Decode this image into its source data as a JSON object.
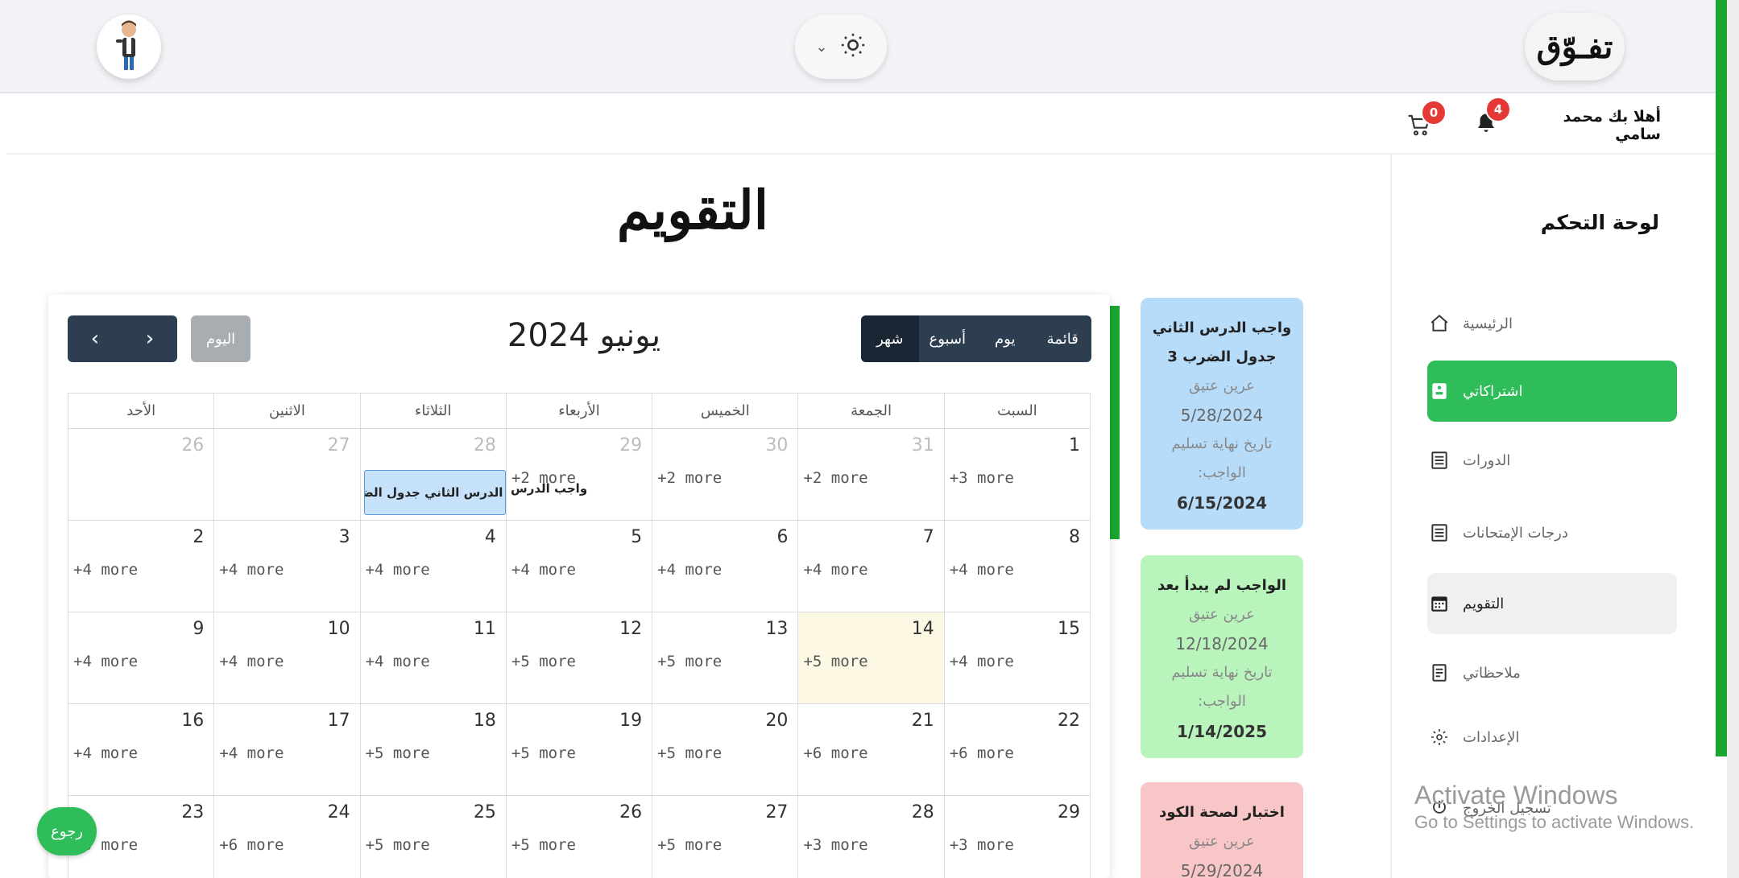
{
  "header": {
    "logo": "تفـوّق",
    "avatar_alt": "avatar"
  },
  "topbar": {
    "greeting": "أهلا بك محمد سامي",
    "notifications_count": "4",
    "cart_count": "0"
  },
  "sidebar": {
    "title": "لوحة التحكم",
    "items": [
      {
        "label": "الرئيسية",
        "icon": "home-icon"
      },
      {
        "label": "اشتراكاتي",
        "icon": "subscription-icon"
      },
      {
        "label": "الدورات",
        "icon": "list-icon"
      },
      {
        "label": "درجات الإمتحانات",
        "icon": "list-icon"
      },
      {
        "label": "التقويم",
        "icon": "calendar-icon"
      },
      {
        "label": "ملاحظاتي",
        "icon": "notes-icon"
      },
      {
        "label": "الإعدادات",
        "icon": "gear-icon"
      },
      {
        "label": "تسجيل الخروج",
        "icon": "power-icon"
      }
    ]
  },
  "page": {
    "title": "التقويم",
    "back": "رجوع"
  },
  "windows_watermark": {
    "line1": "Activate Windows",
    "line2": "Go to Settings to activate Windows."
  },
  "calendar": {
    "month_title": "يونيو 2024",
    "today_label": "اليوم",
    "views": [
      "قائمة",
      "يوم",
      "أسبوع",
      "شهر"
    ],
    "weekdays": [
      "السبت",
      "الجمعة",
      "الخميس",
      "الأربعاء",
      "الثلاثاء",
      "الاثنين",
      "الأحد"
    ],
    "weeks": [
      [
        {
          "d": "1",
          "m": "+3 more"
        },
        {
          "d": "31",
          "m": "+2 more"
        },
        {
          "d": "30",
          "m": "+2 more"
        },
        {
          "d": "29",
          "m": "+2 more"
        },
        {
          "d": "28",
          "m": ""
        },
        {
          "d": "27",
          "m": ""
        },
        {
          "d": "26",
          "m": ""
        }
      ],
      [
        {
          "d": "8",
          "m": "+4 more"
        },
        {
          "d": "7",
          "m": "+4 more"
        },
        {
          "d": "6",
          "m": "+4 more"
        },
        {
          "d": "5",
          "m": "+4 more"
        },
        {
          "d": "4",
          "m": "+4 more"
        },
        {
          "d": "3",
          "m": "+4 more"
        },
        {
          "d": "2",
          "m": "+4 more"
        }
      ],
      [
        {
          "d": "15",
          "m": "+4 more"
        },
        {
          "d": "14",
          "m": "+5 more"
        },
        {
          "d": "13",
          "m": "+5 more"
        },
        {
          "d": "12",
          "m": "+5 more"
        },
        {
          "d": "11",
          "m": "+4 more"
        },
        {
          "d": "10",
          "m": "+4 more"
        },
        {
          "d": "9",
          "m": "+4 more"
        }
      ],
      [
        {
          "d": "22",
          "m": "+6 more"
        },
        {
          "d": "21",
          "m": "+6 more"
        },
        {
          "d": "20",
          "m": "+5 more"
        },
        {
          "d": "19",
          "m": "+5 more"
        },
        {
          "d": "18",
          "m": "+5 more"
        },
        {
          "d": "17",
          "m": "+4 more"
        },
        {
          "d": "16",
          "m": "+4 more"
        }
      ],
      [
        {
          "d": "29",
          "m": "+3 more"
        },
        {
          "d": "28",
          "m": "+3 more"
        },
        {
          "d": "27",
          "m": "+5 more"
        },
        {
          "d": "26",
          "m": "+5 more"
        },
        {
          "d": "25",
          "m": "+5 more"
        },
        {
          "d": "24",
          "m": "+6 more"
        },
        {
          "d": "23",
          "m": "+6 more"
        }
      ]
    ],
    "event_label": "واجب الدرس الثاني جدول الضرب 3",
    "event_spill": "واجب الدرس"
  },
  "assignments": [
    {
      "title": "واجب الدرس الثاني جدول الضرب 3",
      "teacher": "عرين عتيق",
      "date": "5/28/2024",
      "due_label": "تاريخ نهاية تسليم الواجب:",
      "due": "6/15/2024",
      "color": "#b7dcfa"
    },
    {
      "title": "الواجب لم يبدأ بعد",
      "teacher": "عرين عتيق",
      "date": "12/18/2024",
      "due_label": "تاريخ نهاية تسليم الواجب:",
      "due": "1/14/2025",
      "color": "#b9f4bd"
    },
    {
      "title": "اختبار لصحة الكود",
      "teacher": "عرين عتيق",
      "date": "5/29/2024",
      "color": "#f8c6c6"
    }
  ]
}
